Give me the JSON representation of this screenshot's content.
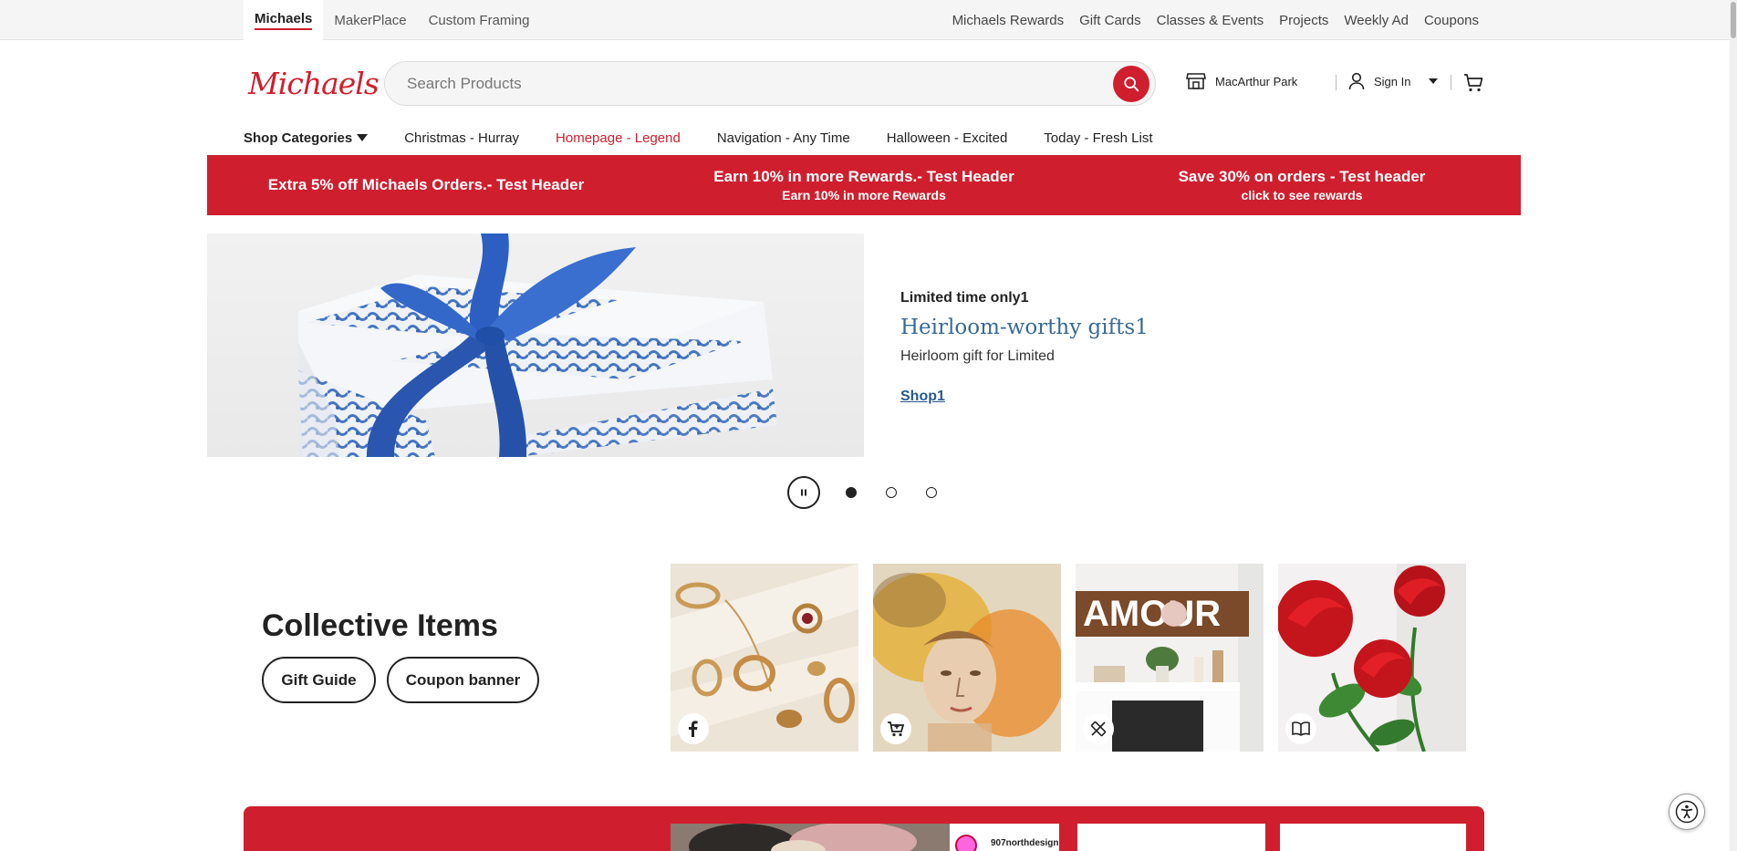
{
  "utility": {
    "tabs": [
      "Michaels",
      "MakerPlace",
      "Custom Framing"
    ],
    "links": [
      "Michaels Rewards",
      "Gift Cards",
      "Classes & Events",
      "Projects",
      "Weekly Ad",
      "Coupons"
    ]
  },
  "header": {
    "logo": "Michaels",
    "search_placeholder": "Search Products",
    "store_name": "MacArthur Park",
    "signin_label": "Sign In"
  },
  "nav": {
    "categories_label": "Shop Categories",
    "items": [
      "Christmas - Hurray",
      "Homepage - Legend",
      "Navigation - Any Time",
      "Halloween - Excited",
      "Today - Fresh List"
    ],
    "highlight_color": "#cf1f2e"
  },
  "promo": [
    {
      "title": "Extra 5% off Michaels Orders.- Test Header",
      "sub": ""
    },
    {
      "title": "Earn 10% in more Rewards.- Test Header",
      "sub": "Earn 10% in more Rewards"
    },
    {
      "title": "Save 30% on orders - Test header",
      "sub": "click to see rewards"
    }
  ],
  "hero": {
    "eyebrow": "Limited time only1",
    "title": "Heirloom-worthy gifts1",
    "description": "Heirloom gift for Limited",
    "link": "Shop1",
    "slides_total": 3,
    "active_slide": 1
  },
  "collective": {
    "title": "Collective Items",
    "buttons": [
      "Gift Guide",
      "Coupon banner"
    ],
    "tiles": [
      {
        "name": "jewelry",
        "icon": "facebook-icon"
      },
      {
        "name": "art-portrait",
        "icon": "shopping-cart-icon"
      },
      {
        "name": "amour-sign",
        "icon": "craft-tools-icon"
      },
      {
        "name": "red-roses",
        "icon": "book-icon"
      }
    ]
  },
  "band": {
    "username": "907northdesign"
  },
  "colors": {
    "brand_red": "#cf1f2e",
    "hero_title_blue": "#3a6a96"
  }
}
